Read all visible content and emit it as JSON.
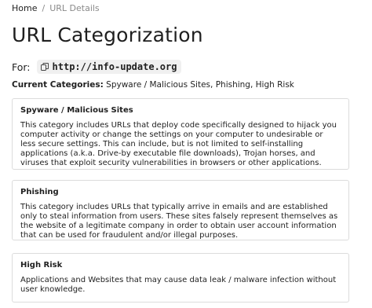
{
  "breadcrumb": {
    "home": "Home",
    "separator": "/",
    "current": "URL Details"
  },
  "page_title": "URL Categorization",
  "for_row": {
    "label": "For:",
    "url": "http://info-update.org",
    "icon": "copy-icon"
  },
  "current_categories": {
    "label": "Current Categories:",
    "value": " Spyware / Malicious Sites, Phishing, High Risk"
  },
  "categories": [
    {
      "title": "Spyware / Malicious Sites",
      "description": "This category includes URLs that deploy code specifically designed to hijack you computer activity or change the settings on your computer to undesirable or less secure settings. This can include, but is not limited to self-installing applications (a.k.a. Drive-by executable file downloads), Trojan horses, and viruses that exploit security vulnerabilities in browsers or other applications."
    },
    {
      "title": "Phishing",
      "description": "This category includes URLs that typically arrive in emails and are established only to steal information from users. These sites falsely represent themselves as the website of a legitimate company in order to obtain user account information that can be used for fraudulent and/or illegal purposes."
    },
    {
      "title": "High Risk",
      "description": "Applications and Websites that may cause data leak / malware infection without user knowledge."
    }
  ]
}
